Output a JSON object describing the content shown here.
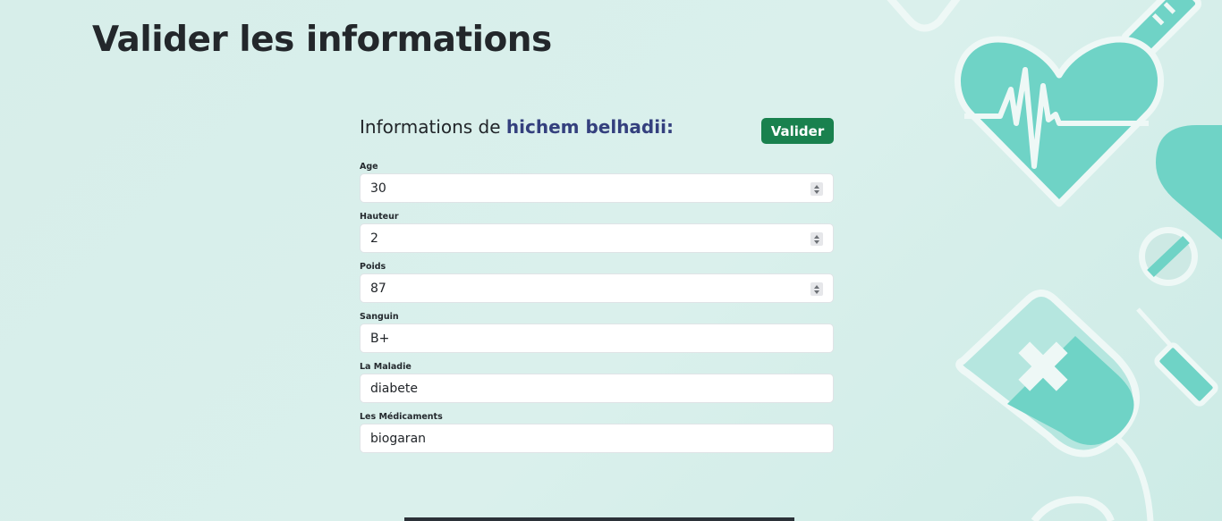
{
  "page": {
    "title": "Valider les informations"
  },
  "form": {
    "heading_prefix": "Informations de ",
    "patient_name": "hichem belhadii",
    "heading_suffix": ":",
    "validate_label": "Valider",
    "fields": {
      "age": {
        "label": "Age",
        "value": "30"
      },
      "hauteur": {
        "label": "Hauteur",
        "value": "2"
      },
      "poids": {
        "label": "Poids",
        "value": "87"
      },
      "sanguin": {
        "label": "Sanguin",
        "value": "B+"
      },
      "maladie": {
        "label": "La Maladie",
        "value": "diabete"
      },
      "medicaments": {
        "label": "Les Médicaments",
        "value": "biogaran"
      }
    }
  },
  "colors": {
    "background": "#d7eeea",
    "accent_teal": "#6fd3c6",
    "button_green": "#19814e",
    "name_blue": "#34407e"
  },
  "decorations": [
    "heart-pulse-icon",
    "pill-icon",
    "syringe-icon",
    "blood-bag-icon"
  ]
}
